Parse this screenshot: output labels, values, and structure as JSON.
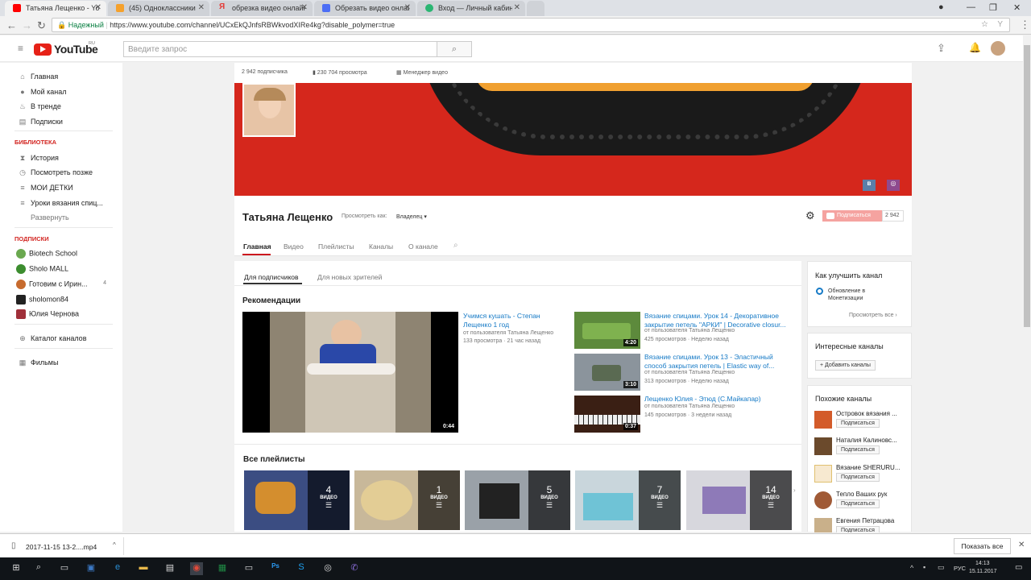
{
  "browser": {
    "tabs": [
      {
        "title": "Татьяна Лещенко - YouT",
        "color": "#ff0000"
      },
      {
        "title": "(45) Одноклассники",
        "color": "#f5a12c"
      },
      {
        "title": "обрезка видео онлайн -",
        "color": "#e53935"
      },
      {
        "title": "Обрезать видео онлайн",
        "color": "#4c6ef5"
      },
      {
        "title": "Вход — Личный кабине",
        "color": "#2bb673"
      }
    ],
    "secure_label": "Надежный",
    "url": "https://www.youtube.com/channel/UCxEkQJnfsRBWkvodXIRe4kg?disable_polymer=true"
  },
  "header": {
    "logo": "YouTube",
    "region": "RU",
    "search_placeholder": "Введите запрос"
  },
  "sidebar": {
    "main": [
      {
        "label": "Главная",
        "icon": "home-icon"
      },
      {
        "label": "Мой канал",
        "icon": "person-icon"
      },
      {
        "label": "В тренде",
        "icon": "flame-icon"
      },
      {
        "label": "Подписки",
        "icon": "subscriptions-icon"
      }
    ],
    "library_title": "БИБЛИОТЕКА",
    "library": [
      {
        "label": "История",
        "icon": "history-icon"
      },
      {
        "label": "Посмотреть позже",
        "icon": "clock-icon"
      },
      {
        "label": "МОИ ДЕТКИ",
        "icon": "playlist-icon"
      },
      {
        "label": "Уроки вязания спиц...",
        "icon": "playlist-icon"
      }
    ],
    "expand": "Развернуть",
    "subs_title": "ПОДПИСКИ",
    "subs": [
      {
        "label": "Biotech School",
        "count": "",
        "color": "#6aa84f"
      },
      {
        "label": "Sholo MALL",
        "count": "",
        "color": "#3c8d2f"
      },
      {
        "label": "Готовим с Ирин...",
        "count": "4",
        "color": "#c76b2e"
      },
      {
        "label": "sholomon84",
        "count": "",
        "color": "#222222"
      },
      {
        "label": "Юлия Чернова",
        "count": "",
        "color": "#a0303a"
      }
    ],
    "catalog": "Каталог каналов",
    "films": "Фильмы"
  },
  "channel": {
    "subscribers": "2 942 подписчика",
    "views": "230 704 просмотра",
    "manager": "Менеджер видео",
    "name": "Татьяна Лещенко",
    "view_as_label": "Просмотреть как:",
    "view_as_value": "Владелец",
    "subscribe": "Подписаться",
    "sub_count": "2 942",
    "tabs": [
      "Главная",
      "Видео",
      "Плейлисты",
      "Каналы",
      "О канале"
    ]
  },
  "content": {
    "subtabs": [
      "Для подписчиков",
      "Для новых зрителей"
    ],
    "rec_title": "Рекомендации",
    "featured": {
      "title": "Учимся кушать - Степан Лещенко 1 год",
      "by": "от пользователя Татьяна Лещенко",
      "meta": "133 просмотра · 21 час назад",
      "duration": "0:44"
    },
    "videos": [
      {
        "title": "Вязание спицами. Урок 14 - Декоративное закрытие петель \"АРКИ\" | Decorative closur...",
        "by": "от пользователя Татьяна Лещенко",
        "meta": "425 просмотров · Неделю назад",
        "duration": "4:20"
      },
      {
        "title": "Вязание спицами. Урок 13 - Эластичный способ закрытия петель | Elastic way of...",
        "by": "от пользователя Татьяна Лещенко",
        "meta": "313 просмотров · Неделю назад",
        "duration": "3:10"
      },
      {
        "title": "Лещенко Юлия - Этюд (С.Майкапар)",
        "by": "от пользователя Татьяна Лещенко",
        "meta": "145 просмотров · 3 недели назад",
        "duration": "0:37"
      }
    ],
    "playlists_title": "Все плейлисты",
    "playlists": [
      {
        "count": "4",
        "label": "ВИДЕО"
      },
      {
        "count": "1",
        "label": "ВИДЕО"
      },
      {
        "count": "5",
        "label": "ВИДЕО"
      },
      {
        "count": "7",
        "label": "ВИДЕО"
      },
      {
        "count": "14",
        "label": "ВИДЕО"
      }
    ]
  },
  "right": {
    "improve_title": "Как улучшить канал",
    "improve_item": "Обновление в Монетизации",
    "view_all": "Просмотреть все",
    "interesting_title": "Интересные каналы",
    "add_channels": "+ Добавить каналы",
    "similar_title": "Похожие каналы",
    "similar": [
      {
        "name": "Островок вязания ...",
        "button": "Подписаться"
      },
      {
        "name": "Наталия Калиновс...",
        "button": "Подписаться"
      },
      {
        "name": "Вязание SHERURU...",
        "button": "Подписаться"
      },
      {
        "name": "Тепло Ваших рук",
        "button": "Подписаться"
      },
      {
        "name": "Евгения Петрацова",
        "button": "Подписаться"
      }
    ]
  },
  "downloads": {
    "file": "2017-11-15 13-2....mp4",
    "show_all": "Показать все"
  },
  "taskbar": {
    "lang": "РУС",
    "time": "14:13",
    "date": "15.11.2017"
  }
}
